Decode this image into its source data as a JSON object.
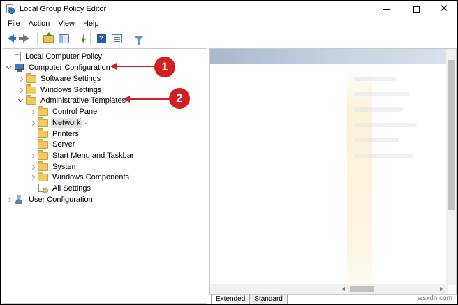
{
  "window": {
    "title": "Local Group Policy Editor",
    "close_glyph": "✕"
  },
  "menu": [
    "File",
    "Action",
    "View",
    "Help"
  ],
  "toolbar": {
    "help_glyph": "?"
  },
  "tree": {
    "root": "Local Computer Policy",
    "computer_config": "Computer Configuration",
    "software_settings": "Software Settings",
    "windows_settings": "Windows Settings",
    "admin_templates": "Administrative Templates",
    "control_panel": "Control Panel",
    "network": "Network",
    "network_marker": "·",
    "printers": "Printers",
    "server": "Server",
    "start_menu": "Start Menu and Taskbar",
    "system": "System",
    "windows_components": "Windows Components",
    "all_settings": "All Settings",
    "user_config": "User Configuration"
  },
  "tabs": [
    "Extended",
    "Standard"
  ],
  "annotations": {
    "callout1": "1",
    "callout2": "2"
  },
  "watermark": "wsxdn.com",
  "colors": {
    "accent": "#d21f1f",
    "selection": "#e1e1e1",
    "folder": "#f1cb62"
  }
}
